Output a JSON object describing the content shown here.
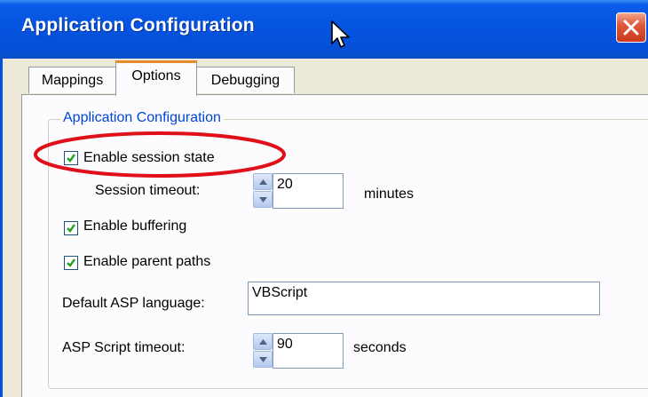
{
  "window": {
    "title": "Application Configuration",
    "title_bar_color": "#0554e0",
    "close_icon": "close-icon"
  },
  "tabs": [
    {
      "label": "Mappings",
      "active": false
    },
    {
      "label": "Options",
      "active": true
    },
    {
      "label": "Debugging",
      "active": false
    }
  ],
  "group": {
    "legend": "Application Configuration"
  },
  "options": {
    "session_state": {
      "label": "Enable session state",
      "checked": true
    },
    "session_timeout": {
      "label": "Session timeout:",
      "value": "20",
      "unit": "minutes"
    },
    "buffering": {
      "label": "Enable buffering",
      "checked": true
    },
    "parent_paths": {
      "label": "Enable parent paths",
      "checked": true
    },
    "asp_language": {
      "label": "Default ASP language:",
      "value": "VBScript"
    },
    "script_timeout": {
      "label": "ASP Script timeout:",
      "value": "90",
      "unit": "seconds"
    }
  },
  "annotation": {
    "highlight_color": "#e0101a",
    "highlight_target": "Enable session state"
  }
}
